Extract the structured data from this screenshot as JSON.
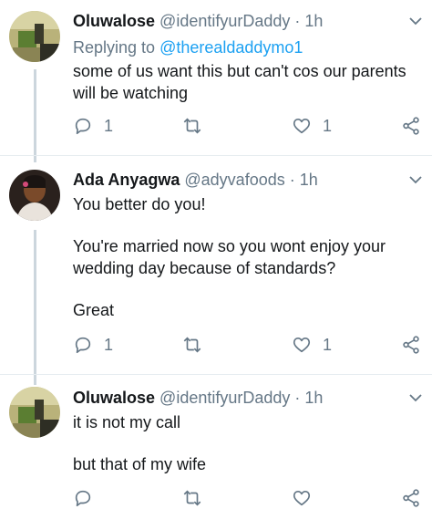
{
  "tweets": [
    {
      "name": "Oluwalose",
      "handle": "@identifyurDaddy",
      "dot": "·",
      "time": "1h",
      "replying_prefix": "Replying to ",
      "replying_to": "@therealdaddymo1",
      "lines": [
        "some of us want this but can't cos our parents",
        "will be watching"
      ],
      "reply_count": "1",
      "like_count": "1"
    },
    {
      "name": "Ada Anyagwa",
      "handle": "@adyvafoods",
      "dot": "·",
      "time": "1h",
      "lines": [
        "You better do you!",
        "",
        "You're married now so you wont enjoy your",
        "wedding day because of standards?",
        "",
        "Great"
      ],
      "reply_count": "1",
      "like_count": "1"
    },
    {
      "name": "Oluwalose",
      "handle": "@identifyurDaddy",
      "dot": "·",
      "time": "1h",
      "lines": [
        "it is not my call",
        "",
        "but that of my wife"
      ]
    }
  ],
  "icons": [
    "chevron-down-icon",
    "reply-icon",
    "retweet-icon",
    "like-icon",
    "share-icon"
  ],
  "colors": {
    "muted": "#657786",
    "link": "#1da1f2",
    "thread_line": "#ccd6dd",
    "divider": "#e6ecf0"
  }
}
